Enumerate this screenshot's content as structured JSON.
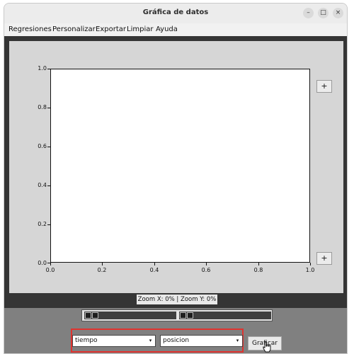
{
  "window": {
    "title": "Gráfica de datos",
    "minimize_icon": "minimize-icon",
    "maximize_icon": "maximize-icon",
    "close_icon": "close-icon"
  },
  "menu": {
    "items": [
      "Regresiones",
      "Personalizar",
      "Exportar",
      "Limpiar",
      "Ayuda"
    ]
  },
  "plot": {
    "y_ticks": [
      "1.0",
      "0.8",
      "0.6",
      "0.4",
      "0.2",
      "0.0"
    ],
    "x_ticks": [
      "0.0",
      "0.2",
      "0.4",
      "0.6",
      "0.8",
      "1.0"
    ],
    "plus_top": "+",
    "plus_bottom": "+"
  },
  "chart_data": {
    "type": "line",
    "series": [],
    "xlim": [
      0.0,
      1.0
    ],
    "ylim": [
      0.0,
      1.0
    ],
    "x_ticks": [
      "0.0",
      "0.2",
      "0.4",
      "0.6",
      "0.8",
      "1.0"
    ],
    "y_ticks": [
      "0.0",
      "0.2",
      "0.4",
      "0.6",
      "0.8",
      "1.0"
    ],
    "grid": false
  },
  "zoom": {
    "label": "Zoom X: 0% | Zoom Y: 0%"
  },
  "controls": {
    "x_select_value": "tiempo",
    "y_select_value": "posicion",
    "graficar_label": "Graficar"
  }
}
